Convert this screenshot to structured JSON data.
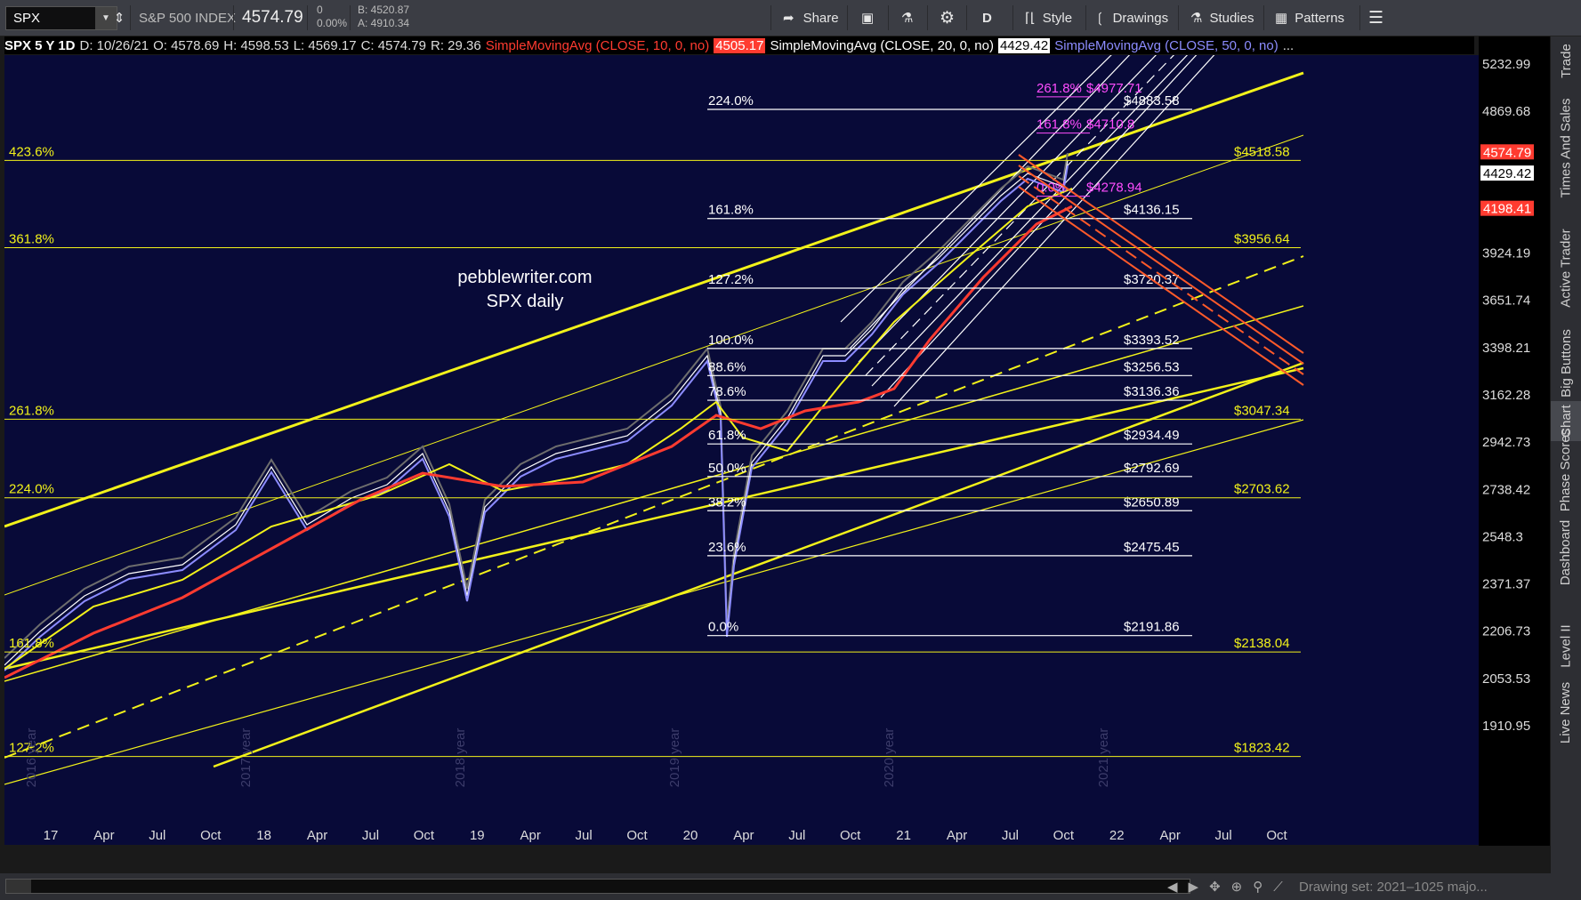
{
  "toolbar": {
    "symbol": "SPX",
    "name": "S&P 500 INDEX",
    "last": "4574.79",
    "change": "0",
    "change_pct": "0.00%",
    "bid": "B: 4520.87",
    "ask": "A: 4910.34",
    "share": "Share",
    "timeframe": "D",
    "style": "Style",
    "drawings": "Drawings",
    "studies": "Studies",
    "patterns": "Patterns"
  },
  "legend": {
    "symbol": "SPX 5 Y 1D",
    "date": "D: 10/26/21",
    "open": "O: 4578.69",
    "high": "H: 4598.53",
    "low": "L: 4569.17",
    "close": "C: 4574.79",
    "range": "R: 29.36",
    "sma10": "SimpleMovingAvg (CLOSE, 10, 0, no)",
    "sma10_val": "4505.17",
    "sma20": "SimpleMovingAvg (CLOSE, 20, 0, no)",
    "sma20_val": "4429.42",
    "sma50": "SimpleMovingAvg (CLOSE, 50, 0, no)",
    "more": "..."
  },
  "colors": {
    "sma10": "#ff3b30",
    "sma20": "#ffffff",
    "sma50": "#8c8cff",
    "yellow": "#f2f21a",
    "bg": "#080a38"
  },
  "watermark": {
    "line1": "pebblewriter.com",
    "line2": "SPX daily"
  },
  "price_axis": [
    "5232.99",
    "4869.68",
    "4574.79",
    "4429.42",
    "4198.41",
    "3924.19",
    "3651.74",
    "3398.21",
    "3162.28",
    "2942.73",
    "2738.42",
    "2548.3",
    "2371.37",
    "2206.73",
    "2053.53",
    "1910.95"
  ],
  "price_badges": [
    {
      "value": "4574.79",
      "color": "#ff3b30"
    },
    {
      "value": "4429.42",
      "color": "#ffffff"
    },
    {
      "value": "4198.41",
      "color": "#ff3b30"
    }
  ],
  "fib_white": [
    {
      "pct": "224.0%",
      "val": "$4883.58"
    },
    {
      "pct": "161.8%",
      "val": "$4136.15"
    },
    {
      "pct": "127.2%",
      "val": "$3720.37"
    },
    {
      "pct": "100.0%",
      "val": "$3393.52"
    },
    {
      "pct": "88.6%",
      "val": "$3256.53"
    },
    {
      "pct": "78.6%",
      "val": "$3136.36"
    },
    {
      "pct": "61.8%",
      "val": "$2934.49"
    },
    {
      "pct": "50.0%",
      "val": "$2792.69"
    },
    {
      "pct": "38.2%",
      "val": "$2650.89"
    },
    {
      "pct": "23.6%",
      "val": "$2475.45"
    },
    {
      "pct": "0.0%",
      "val": "$2191.86"
    }
  ],
  "fib_yellow": [
    {
      "pct": "423.6%",
      "val": "$4518.58"
    },
    {
      "pct": "361.8%",
      "val": "$3956.64"
    },
    {
      "pct": "261.8%",
      "val": "$3047.34"
    },
    {
      "pct": "224.0%",
      "val": "$2703.62"
    },
    {
      "pct": "161.8%",
      "val": "$2138.04"
    },
    {
      "pct": "127.2%",
      "val": "$1823.42"
    }
  ],
  "fib_magenta": [
    {
      "pct": "261.8%",
      "val": "$4977.71"
    },
    {
      "pct": "161.8%",
      "val": "$4710.8"
    },
    {
      "pct": "0.0%",
      "val": "$4278.94"
    }
  ],
  "x_axis": [
    "17",
    "Apr",
    "Jul",
    "Oct",
    "18",
    "Apr",
    "Jul",
    "Oct",
    "19",
    "Apr",
    "Jul",
    "Oct",
    "20",
    "Apr",
    "Jul",
    "Oct",
    "21",
    "Apr",
    "Jul",
    "Oct",
    "22",
    "Apr",
    "Jul",
    "Oct"
  ],
  "year_labels": [
    "2016 year",
    "2017 year",
    "2018 year",
    "2019 year",
    "2020 year",
    "2021 year"
  ],
  "side_tabs": [
    "Trade",
    "Times And Sales",
    "Active Trader",
    "Big Buttons",
    "Chart",
    "Phase Scores",
    "Dashboard",
    "Level II",
    "Live News"
  ],
  "drawing_set": "Drawing set: 2021–1025 majo..."
}
